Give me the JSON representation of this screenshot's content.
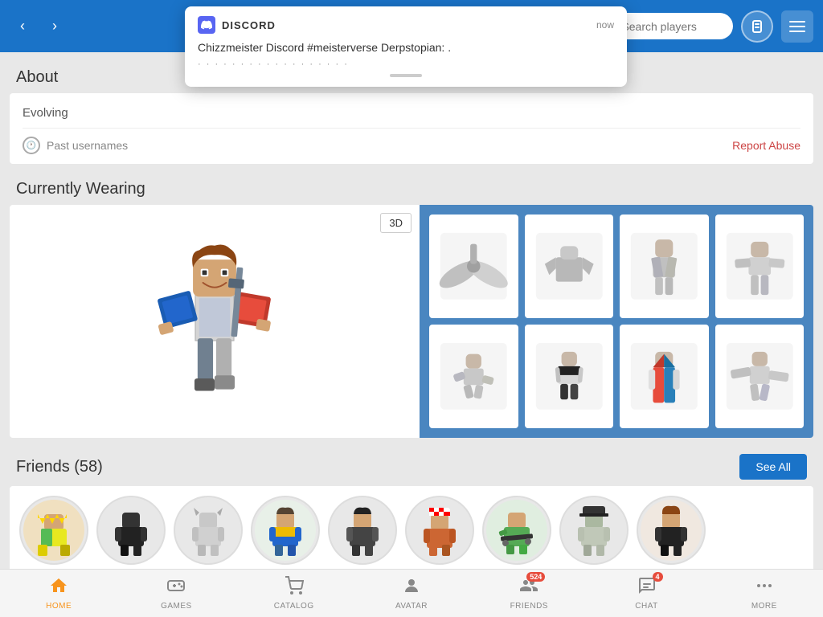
{
  "nav": {
    "back_label": "‹",
    "forward_label": "›",
    "search_placeholder": "Search players",
    "robux_label": "RS",
    "menu_label": "☰"
  },
  "about": {
    "section_title": "About",
    "description": "Evolving",
    "past_usernames_label": "Past usernames",
    "report_abuse_label": "Report Abuse"
  },
  "wearing": {
    "section_title": "Currently Wearing",
    "three_d_label": "3D"
  },
  "friends": {
    "section_title": "Friends (58)",
    "see_all_label": "See All",
    "count": 58
  },
  "tabs": [
    {
      "id": "home",
      "label": "HOME",
      "active": true
    },
    {
      "id": "games",
      "label": "GAMES",
      "active": false
    },
    {
      "id": "catalog",
      "label": "CATALOG",
      "active": false
    },
    {
      "id": "avatar",
      "label": "AVATAR",
      "active": false
    },
    {
      "id": "friends",
      "label": "FRIENDS",
      "badge": "524",
      "active": false
    },
    {
      "id": "chat",
      "label": "CHAT",
      "badge": "4",
      "active": false
    },
    {
      "id": "more",
      "label": "MORE",
      "active": false
    }
  ],
  "discord": {
    "app_name": "DISCORD",
    "time": "now",
    "message": "Chizzmeister Discord #meisterverse Derpstopian: ."
  }
}
